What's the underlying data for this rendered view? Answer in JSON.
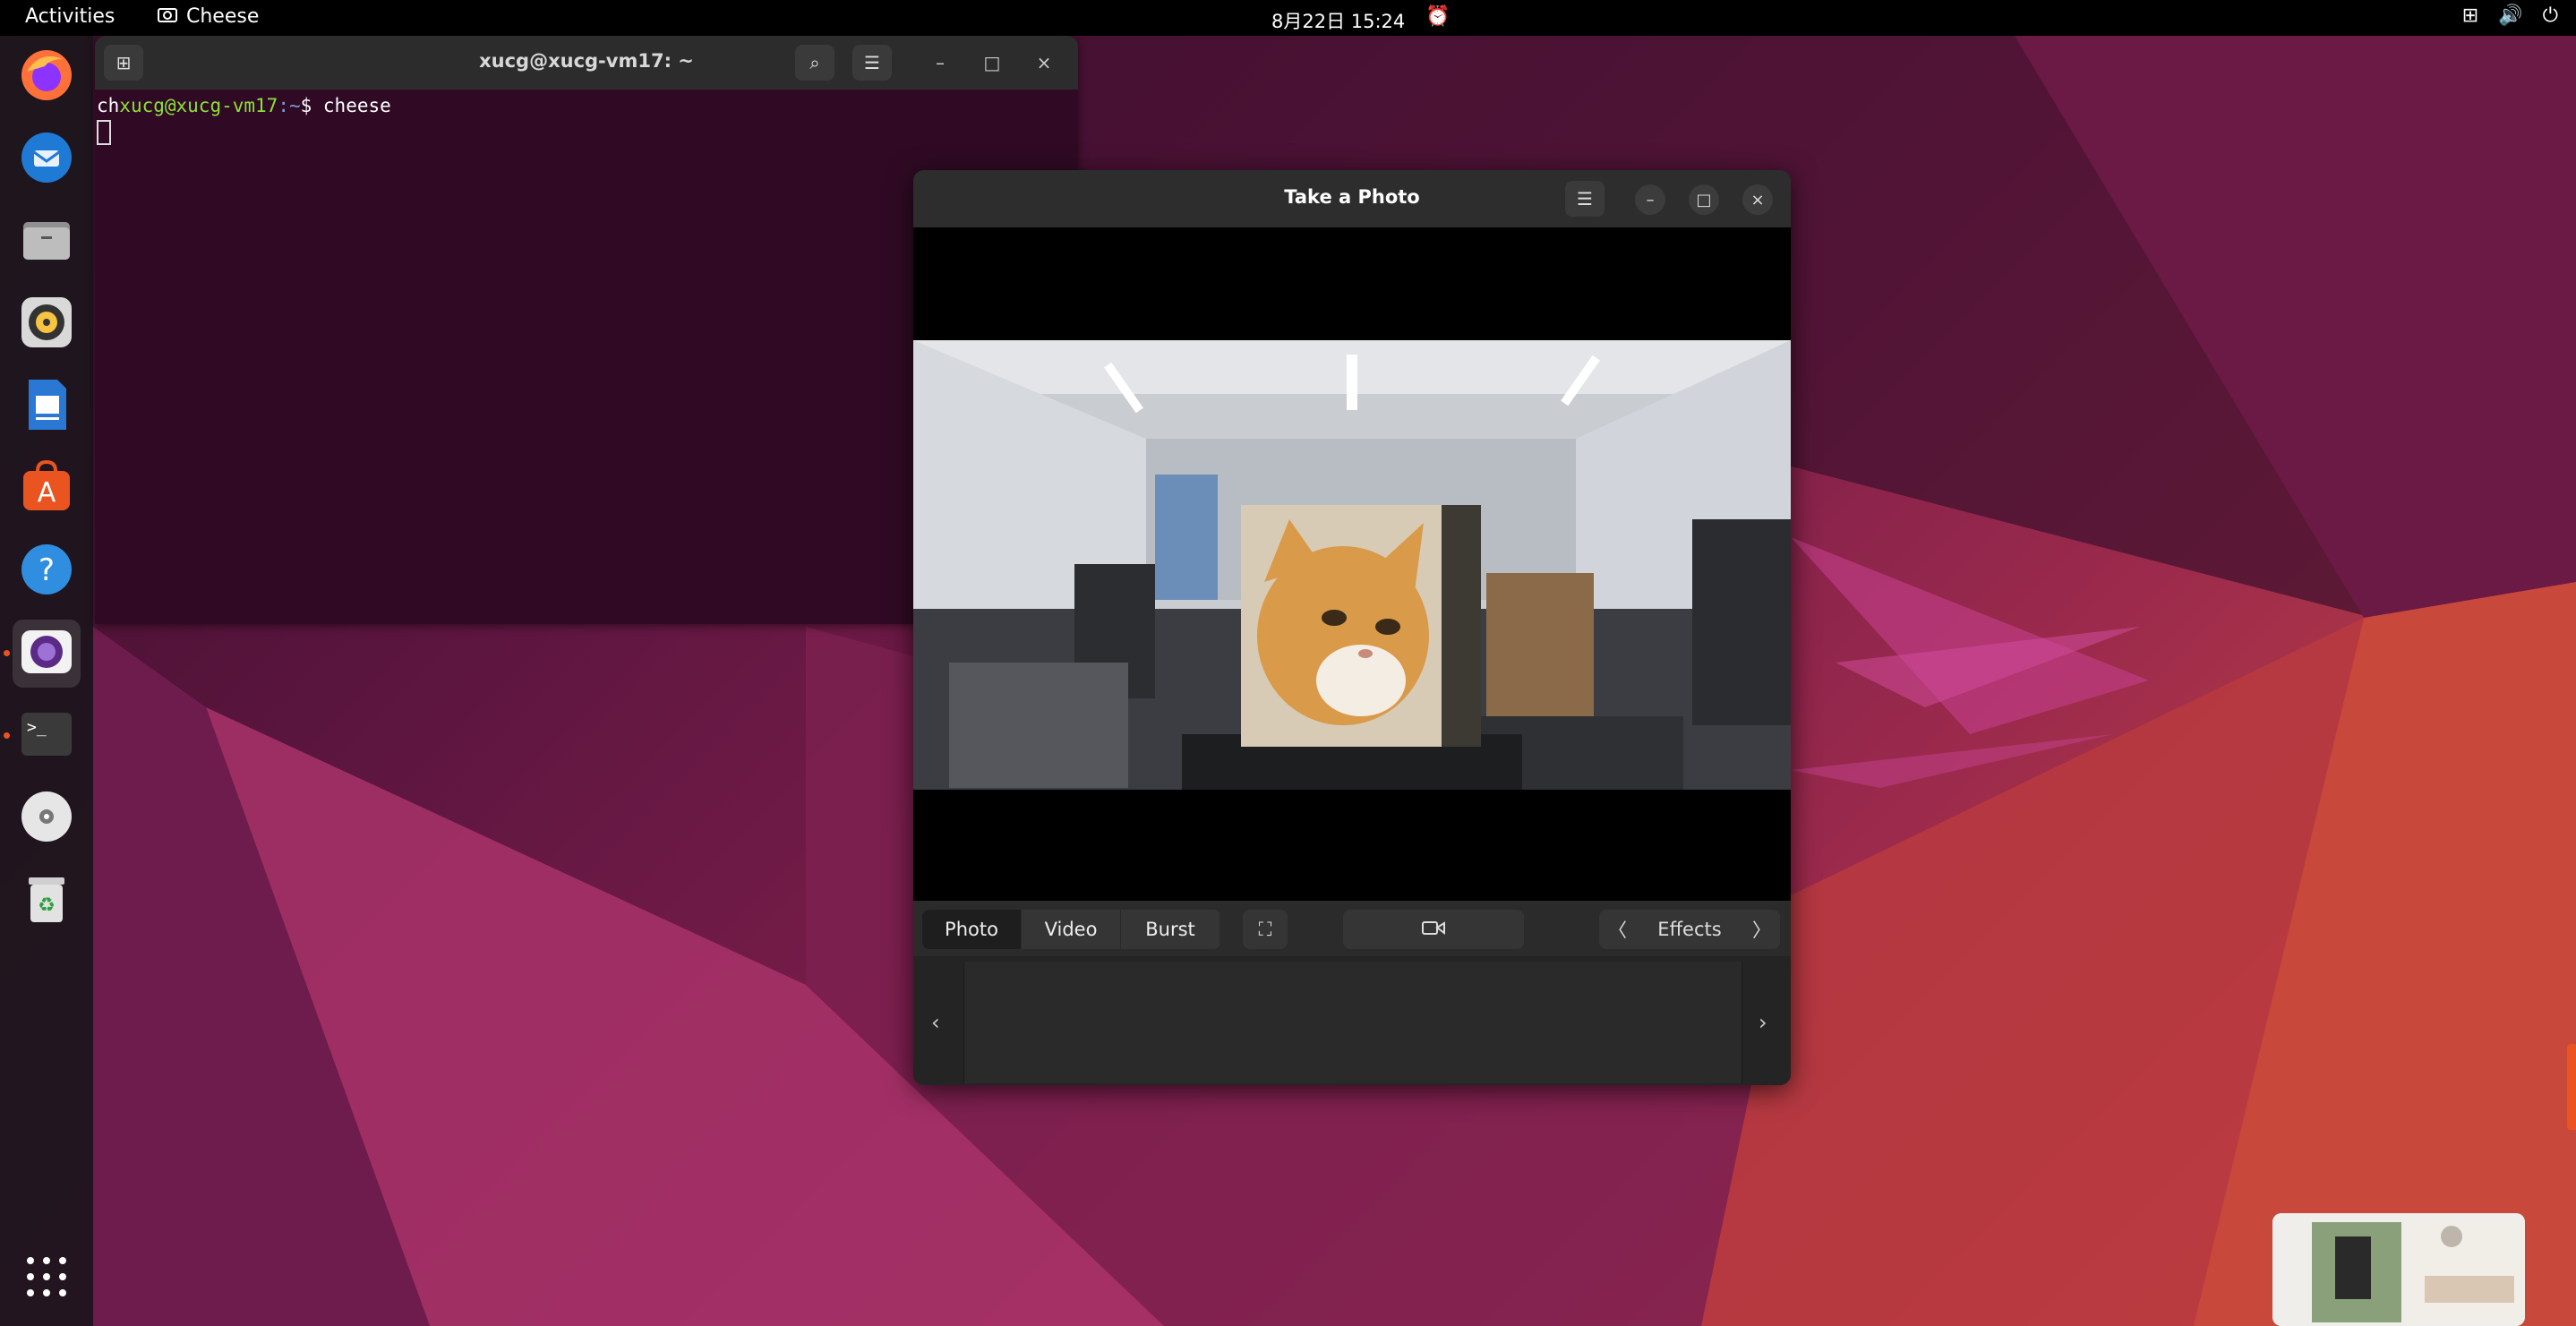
{
  "topbar": {
    "activities": "Activities",
    "app_name": "Cheese",
    "clock": "8月22日  15:24"
  },
  "dock": {
    "apps": [
      "firefox-icon",
      "thunderbird-icon",
      "files-icon",
      "rhythmbox-icon",
      "writer-icon",
      "app-center-icon",
      "help-icon",
      "cheese-icon",
      "terminal-icon",
      "disc-icon",
      "trash-icon",
      "show-apps-icon"
    ]
  },
  "terminal": {
    "title": "xucg@xucg-vm17: ~",
    "prompt_prefix": "ch",
    "prompt_user": "xucg@xucg-vm17",
    "prompt_path": ":~",
    "prompt_symbol": "$ ",
    "command": "cheese"
  },
  "cheese": {
    "title": "Take a Photo",
    "modes": [
      "Photo",
      "Video",
      "Burst"
    ],
    "selected_mode": "Photo",
    "effects_label": "Effects"
  },
  "colors": {
    "accent": "#e95420",
    "terminal_bg": "#300a24",
    "prompt_green": "#8ae234"
  }
}
